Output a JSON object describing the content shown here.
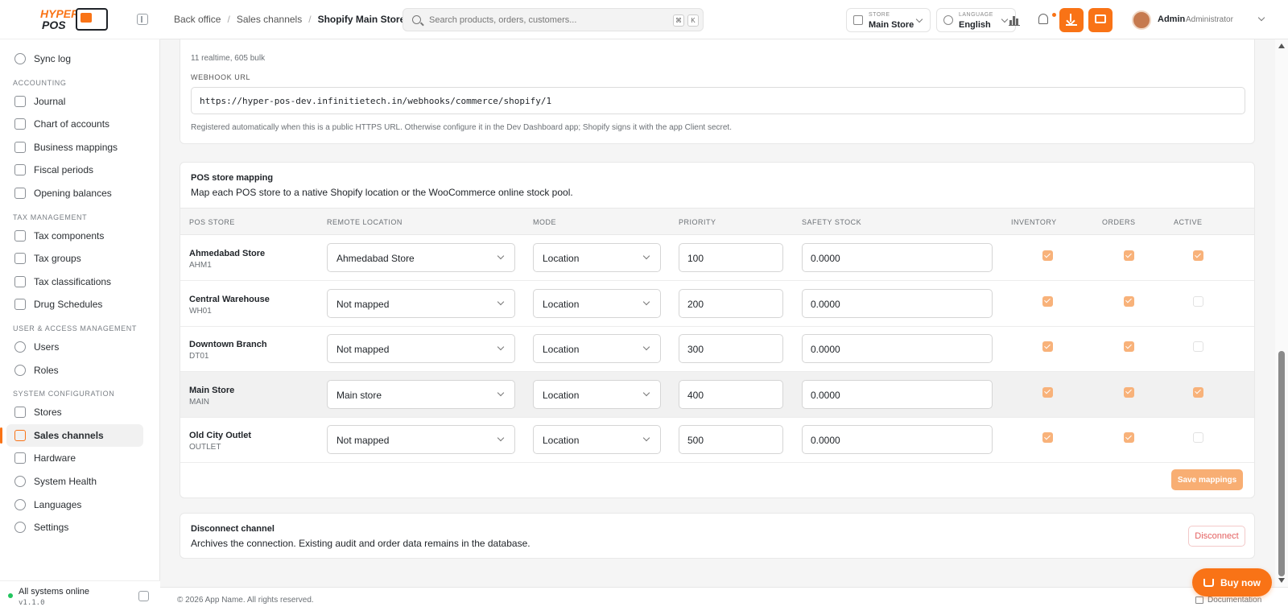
{
  "brand": {
    "line1": "HYPER",
    "line2": "POS"
  },
  "sidebar": {
    "items_top": [
      {
        "label": "Sync log",
        "icon": "sync-icon"
      }
    ],
    "sections": [
      {
        "title": "ACCOUNTING",
        "items": [
          {
            "label": "Journal",
            "icon": "journal-icon"
          },
          {
            "label": "Chart of accounts",
            "icon": "list-icon"
          },
          {
            "label": "Business mappings",
            "icon": "external-link-icon"
          },
          {
            "label": "Fiscal periods",
            "icon": "lock-icon"
          },
          {
            "label": "Opening balances",
            "icon": "document-icon"
          }
        ]
      },
      {
        "title": "TAX MANAGEMENT",
        "items": [
          {
            "label": "Tax components",
            "icon": "tag-icon"
          },
          {
            "label": "Tax groups",
            "icon": "list-tree-icon"
          },
          {
            "label": "Tax classifications",
            "icon": "list-icon"
          },
          {
            "label": "Drug Schedules",
            "icon": "clipboard-icon"
          }
        ]
      },
      {
        "title": "USER & ACCESS MANAGEMENT",
        "items": [
          {
            "label": "Users",
            "icon": "user-icon"
          },
          {
            "label": "Roles",
            "icon": "shield-icon"
          }
        ]
      },
      {
        "title": "SYSTEM CONFIGURATION",
        "items": [
          {
            "label": "Stores",
            "icon": "store-icon"
          },
          {
            "label": "Sales channels",
            "icon": "external-link-icon",
            "active": true
          },
          {
            "label": "Hardware",
            "icon": "printer-icon"
          },
          {
            "label": "System Health",
            "icon": "shield-icon"
          },
          {
            "label": "Languages",
            "icon": "globe-icon"
          },
          {
            "label": "Settings",
            "icon": "gear-icon"
          }
        ]
      }
    ],
    "status": {
      "text": "All systems online",
      "version": "v1.1.0",
      "color": "#22c55e"
    }
  },
  "header": {
    "breadcrumbs": [
      "Back office",
      "Sales channels",
      "Shopify Main Store"
    ],
    "search_placeholder": "Search products, orders, customers...",
    "kbd1": "⌘",
    "kbd2": "K",
    "store_caption": "STORE",
    "store_value": "Main Store",
    "language_caption": "LANGUAGE",
    "language_value": "English",
    "user_name": "Admin",
    "user_role": "Administrator",
    "accent": "#f97316"
  },
  "webhook": {
    "stats": "11 realtime, 605 bulk",
    "caption": "WEBHOOK URL",
    "url": "https://hyper-pos-dev.infinitietech.in/webhooks/commerce/shopify/1",
    "help": "Registered automatically when this is a public HTTPS URL. Otherwise configure it in the Dev Dashboard app; Shopify signs it with the app Client secret."
  },
  "mapping": {
    "title": "POS store mapping",
    "subtitle": "Map each POS store to a native Shopify location or the WooCommerce online stock pool.",
    "columns": [
      "POS STORE",
      "REMOTE LOCATION",
      "MODE",
      "PRIORITY",
      "SAFETY STOCK",
      "INVENTORY",
      "ORDERS",
      "ACTIVE"
    ],
    "rows": [
      {
        "name": "Ahmedabad Store",
        "code": "AHM1",
        "remote": "Ahmedabad Store",
        "mode": "Location",
        "priority": "100",
        "safety": "0.0000",
        "inventory": true,
        "orders": true,
        "active": true
      },
      {
        "name": "Central Warehouse",
        "code": "WH01",
        "remote": "Not mapped",
        "mode": "Location",
        "priority": "200",
        "safety": "0.0000",
        "inventory": true,
        "orders": true,
        "active": false
      },
      {
        "name": "Downtown Branch",
        "code": "DT01",
        "remote": "Not mapped",
        "mode": "Location",
        "priority": "300",
        "safety": "0.0000",
        "inventory": true,
        "orders": true,
        "active": false
      },
      {
        "name": "Main Store",
        "code": "MAIN",
        "remote": "Main store",
        "mode": "Location",
        "priority": "400",
        "safety": "0.0000",
        "inventory": true,
        "orders": true,
        "active": true
      },
      {
        "name": "Old City Outlet",
        "code": "OUTLET",
        "remote": "Not mapped",
        "mode": "Location",
        "priority": "500",
        "safety": "0.0000",
        "inventory": true,
        "orders": true,
        "active": false
      }
    ],
    "save_label": "Save mappings"
  },
  "disconnect": {
    "title": "Disconnect channel",
    "subtitle": "Archives the connection. Existing audit and order data remains in the database.",
    "button": "Disconnect"
  },
  "footer": {
    "copyright": "© 2026 App Name. All rights reserved.",
    "doc_link": "Documentation"
  },
  "buy_now": "Buy now"
}
